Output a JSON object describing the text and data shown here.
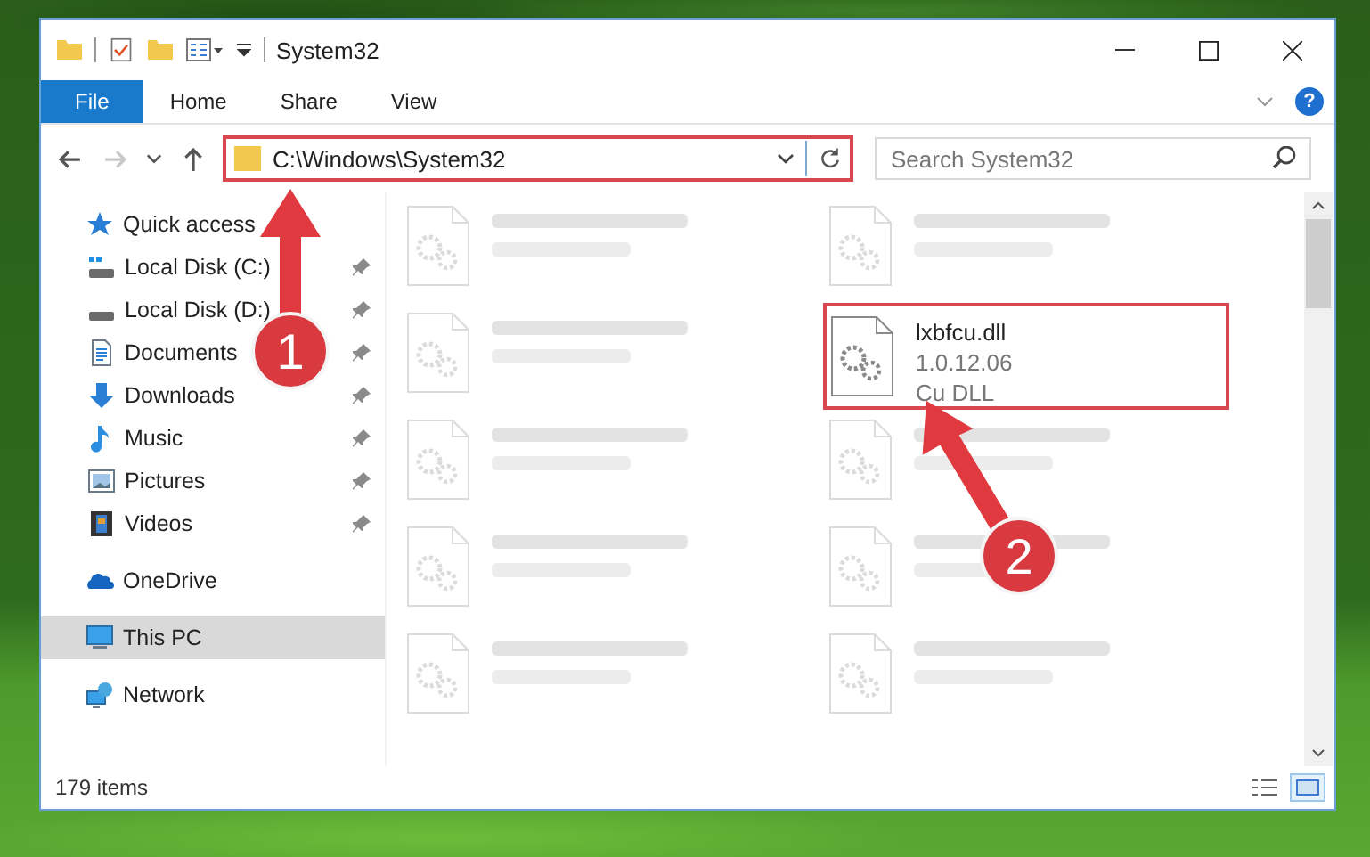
{
  "window": {
    "title": "System32"
  },
  "ribbon": {
    "tabs": [
      {
        "label": "File",
        "selected": true
      },
      {
        "label": "Home",
        "selected": false
      },
      {
        "label": "Share",
        "selected": false
      },
      {
        "label": "View",
        "selected": false
      }
    ],
    "help": "?"
  },
  "navigation": {
    "buttons": [
      {
        "kind": "back",
        "disabled": false
      },
      {
        "kind": "forward",
        "disabled": true
      },
      {
        "kind": "recent",
        "disabled": false
      },
      {
        "kind": "up",
        "disabled": false
      }
    ]
  },
  "address_bar": {
    "path": "C:\\Windows\\System32",
    "highlighted": true
  },
  "search": {
    "placeholder": "Search System32"
  },
  "sidebar": {
    "items": [
      {
        "label": "Quick access",
        "kind": "star",
        "selected": false,
        "children": [
          {
            "label": "Local Disk (C:)",
            "kind": "system-drive",
            "pinned": true,
            "selected": false
          },
          {
            "label": "Local Disk (D:)",
            "kind": "drive",
            "pinned": true,
            "selected": false
          },
          {
            "label": "Documents",
            "kind": "documents",
            "pinned": true,
            "selected": false
          },
          {
            "label": "Downloads",
            "kind": "downloads",
            "pinned": true,
            "selected": false
          },
          {
            "label": "Music",
            "kind": "music",
            "pinned": true,
            "selected": false
          },
          {
            "label": "Pictures",
            "kind": "pictures",
            "pinned": true,
            "selected": false
          },
          {
            "label": "Videos",
            "kind": "videos",
            "pinned": true,
            "selected": false
          }
        ]
      },
      {
        "label": "OneDrive",
        "kind": "cloud",
        "selected": false
      },
      {
        "label": "This PC",
        "kind": "computer",
        "selected": true
      },
      {
        "label": "Network",
        "kind": "network",
        "selected": false
      }
    ]
  },
  "files": [
    {
      "kind": "blurred"
    },
    {
      "kind": "blurred"
    },
    {
      "kind": "blurred"
    },
    {
      "kind": "file",
      "name": "lxbfcu.dll",
      "lines": [
        "1.0.12.06",
        "Cu DLL"
      ],
      "highlighted": true
    },
    {
      "kind": "blurred"
    },
    {
      "kind": "blurred"
    },
    {
      "kind": "blurred"
    },
    {
      "kind": "blurred"
    },
    {
      "kind": "blurred"
    },
    {
      "kind": "blurred"
    }
  ],
  "status_bar": {
    "count": "179 items",
    "view_buttons": [
      {
        "kind": "details",
        "selected": false
      },
      {
        "kind": "tiles",
        "selected": true
      }
    ]
  },
  "annotations": [
    {
      "number": "1"
    },
    {
      "number": "2"
    }
  ]
}
